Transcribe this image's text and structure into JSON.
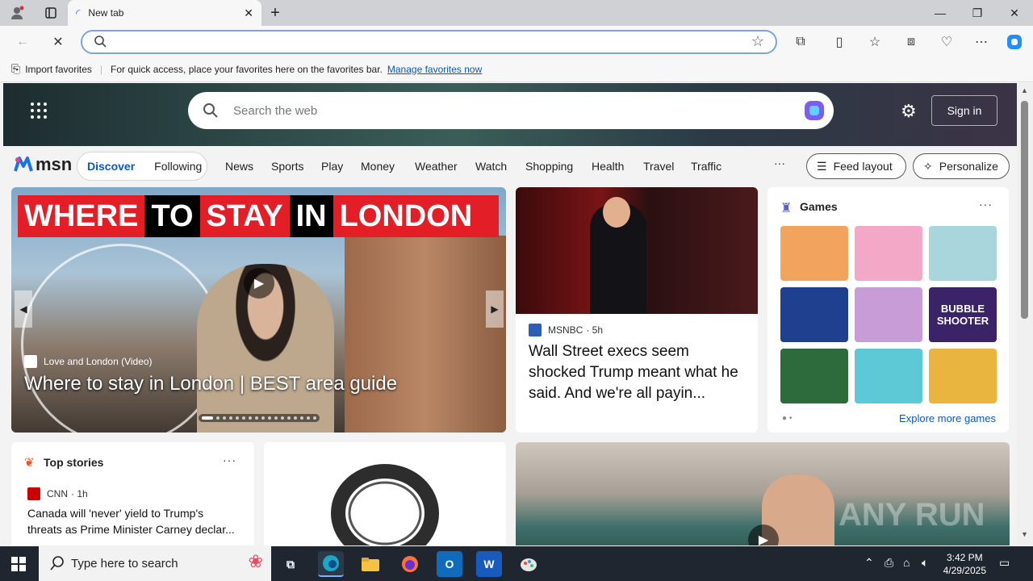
{
  "browser": {
    "tab_title": "New tab",
    "favorites_bar": {
      "import_label": "Import favorites",
      "hint_text": "For quick access, place your favorites here on the favorites bar.",
      "manage_link": "Manage favorites now"
    }
  },
  "msn": {
    "search_placeholder": "Search the web",
    "sign_in": "Sign in",
    "logo_text": "msn",
    "feed_toggle": [
      "Discover",
      "Following"
    ],
    "nav_items": [
      "News",
      "Sports",
      "Play",
      "Money",
      "Weather",
      "Watch",
      "Shopping",
      "Health",
      "Travel",
      "Traffic"
    ],
    "feed_layout": "Feed layout",
    "personalize": "Personalize",
    "hero": {
      "banner_words": [
        "WHERE",
        "TO",
        "STAY",
        "IN",
        "LONDON"
      ],
      "source": "Love and London (Video)",
      "title": "Where to stay in London | BEST area guide"
    },
    "news": {
      "source": "MSNBC",
      "age": "· 5h",
      "title": "Wall Street execs seem shocked Trump meant what he said. And we're all payin..."
    },
    "games": {
      "title": "Games",
      "explore": "Explore more games",
      "tiles": [
        {
          "name": "tile1",
          "color": "#f2a35d"
        },
        {
          "name": "tile2",
          "color": "#f3a8c8"
        },
        {
          "name": "tile3",
          "color": "#a9d5dd"
        },
        {
          "name": "tile4",
          "color": "#1f3f8f"
        },
        {
          "name": "tile5",
          "color": "#c89cd6"
        },
        {
          "name": "bubble-shooter",
          "color": "#3a2366",
          "label": "BUBBLE SHOOTER"
        },
        {
          "name": "mahjong",
          "color": "#2d6b3c"
        },
        {
          "name": "tile8",
          "color": "#5ec9d6"
        },
        {
          "name": "crazy-games",
          "color": "#e9b53f"
        }
      ]
    },
    "top_stories": {
      "title": "Top stories",
      "source": "CNN",
      "age": "· 1h",
      "headline": "Canada will 'never' yield to Trump's threats as Prime Minister Carney declar..."
    }
  },
  "taskbar": {
    "search_placeholder": "Type here to search",
    "time": "3:42 PM",
    "date": "4/29/2025"
  },
  "watermark": "ANY RUN"
}
